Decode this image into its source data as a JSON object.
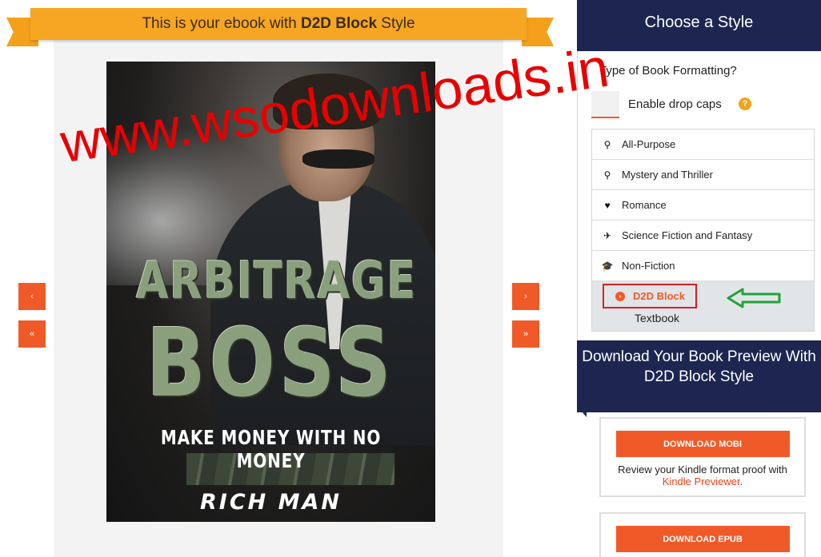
{
  "preview": {
    "ribbon_prefix": "This is your ebook with ",
    "ribbon_style": "D2D Block",
    "ribbon_suffix": " Style",
    "cover": {
      "title_line1": "ARBITRAGE",
      "title_line2": "BOSS",
      "subtitle": "MAKE MONEY WITH NO MONEY",
      "author": "RICH MAN"
    },
    "nav": {
      "prev": "‹",
      "first": "«",
      "next": "›",
      "last": "»"
    }
  },
  "watermark": "www.wsodownloads.in",
  "style_panel": {
    "header": "Choose a Style",
    "question": "Type of Book Formatting?",
    "dropcaps_label": "Enable drop caps",
    "help_glyph": "?",
    "styles": [
      {
        "label": "All-Purpose",
        "icon": "search-icon",
        "glyph": "⚲"
      },
      {
        "label": "Mystery and Thriller",
        "icon": "search-icon",
        "glyph": "⚲"
      },
      {
        "label": "Romance",
        "icon": "heart-icon",
        "glyph": "♥"
      },
      {
        "label": "Science Fiction and Fantasy",
        "icon": "fighter-jet-icon",
        "glyph": "✈"
      },
      {
        "label": "Non-Fiction",
        "icon": "graduation-cap-icon",
        "glyph": "🎓"
      }
    ],
    "selected_style": "D2D Block",
    "selected_glyph": "›",
    "extra_style": "Textbook"
  },
  "download": {
    "header": "Download Your Book Preview With D2D Block Style",
    "mobi_button": "DOWNLOAD MOBI",
    "mobi_desc_prefix": "Review your Kindle format proof with ",
    "mobi_link": "Kindle Previewer",
    "mobi_desc_suffix": ".",
    "epub_button": "DOWNLOAD EPUB"
  },
  "colors": {
    "accent": "#f05a28",
    "navy": "#1c2651",
    "ribbon": "#f6a623",
    "highlight_box": "#d81f26",
    "arrow": "#22a33a"
  }
}
